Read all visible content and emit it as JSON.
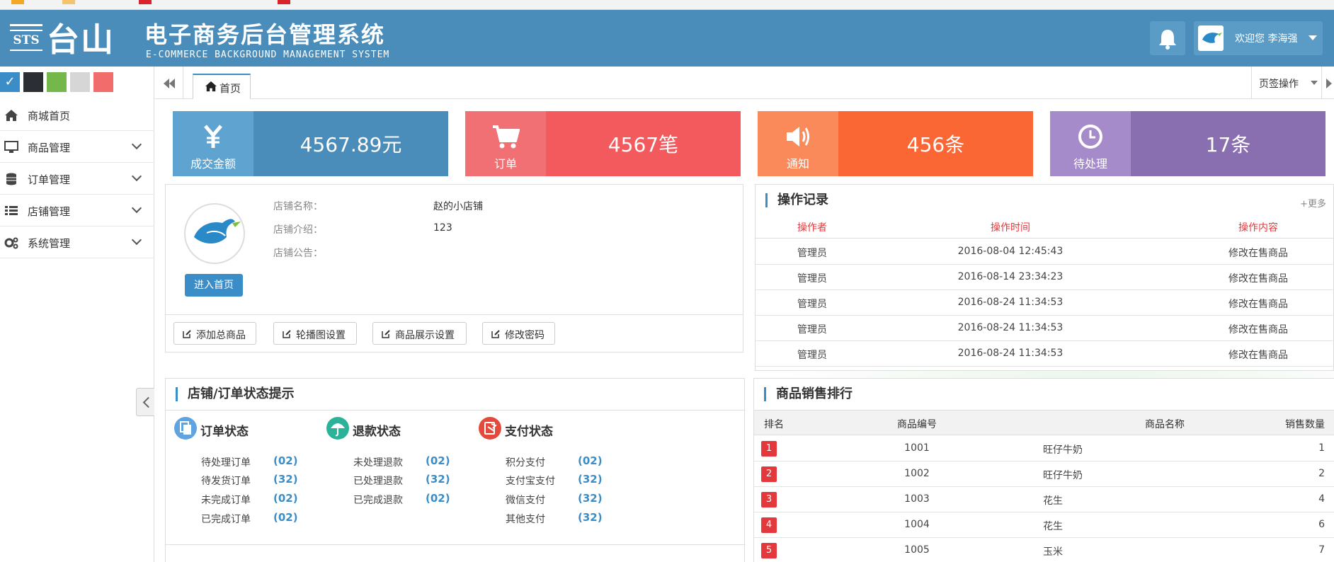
{
  "header": {
    "logo_sts": "STS",
    "logo_text": "台山",
    "title": "电子商务后台管理系统",
    "subtitle": "E-COMMERCE BACKGROUND MANAGEMENT SYSTEM",
    "welcome": "欢迎您 李海强",
    "bell_icon": "bell-icon"
  },
  "theme_swatches": [
    "#3b8dc8",
    "#2b2f33",
    "#74b84b",
    "#d6d6d6",
    "#f36c6c"
  ],
  "sidebar": {
    "items": [
      {
        "label": "商城首页",
        "icon": "home-icon"
      },
      {
        "label": "商品管理",
        "icon": "monitor-icon"
      },
      {
        "label": "订单管理",
        "icon": "database-icon"
      },
      {
        "label": "店铺管理",
        "icon": "list-icon"
      },
      {
        "label": "系统管理",
        "icon": "gears-icon"
      }
    ]
  },
  "tabs": {
    "home": "首页",
    "ops": "页签操作"
  },
  "stats": [
    {
      "label": "成交金额",
      "value": "4567.89元",
      "icon": "yen-icon",
      "left_color": "#5fa3d0",
      "right_color": "#4a8dba"
    },
    {
      "label": "订单",
      "value": "4567笔",
      "icon": "cart-icon",
      "left_color": "#f07074",
      "right_color": "#f25a5e"
    },
    {
      "label": "通知",
      "value": "456条",
      "icon": "speaker-icon",
      "left_color": "#fb8a5a",
      "right_color": "#fb6635"
    },
    {
      "label": "待处理",
      "value": "17条",
      "icon": "clock-icon",
      "left_color": "#a58bc9",
      "right_color": "#8a6fb0"
    }
  ],
  "store": {
    "name_label": "店铺名称：",
    "name_value": "赵的小店铺",
    "intro_label": "店铺介绍：",
    "intro_value": "123",
    "notice_label": "店铺公告：",
    "enter_button": "进入首页",
    "actions": [
      "添加总商品",
      "轮播图设置",
      "商品展示设置",
      "修改密码"
    ]
  },
  "ops_record": {
    "title": "操作记录",
    "more": "+更多",
    "headers": [
      "操作者",
      "操作时间",
      "操作内容"
    ],
    "rows": [
      [
        "管理员",
        "2016-08-04 12:45:43",
        "修改在售商品"
      ],
      [
        "管理员",
        "2016-08-14 23:34:23",
        "修改在售商品"
      ],
      [
        "管理员",
        "2016-08-24 11:34:53",
        "修改在售商品"
      ],
      [
        "管理员",
        "2016-08-24 11:34:53",
        "修改在售商品"
      ],
      [
        "管理员",
        "2016-08-24 11:34:53",
        "修改在售商品"
      ]
    ]
  },
  "status_panel": {
    "title": "店铺/订单状态提示",
    "groups": [
      {
        "title": "订单状态",
        "icon": "copy-icon",
        "color": "#5fa3e0",
        "items": [
          [
            "待处理订单",
            "(02)"
          ],
          [
            "待发货订单",
            "(32)"
          ],
          [
            "未完成订单",
            "(02)"
          ],
          [
            "已完成订单",
            "(02)"
          ]
        ]
      },
      {
        "title": "退款状态",
        "icon": "umbrella-icon",
        "color": "#2bb39a",
        "items": [
          [
            "未处理退款",
            "(02)"
          ],
          [
            "已处理退款",
            "(32)"
          ],
          [
            "已完成退款",
            "(02)"
          ]
        ]
      },
      {
        "title": "支付状态",
        "icon": "payment-icon",
        "color": "#e4493c",
        "items": [
          [
            "积分支付",
            "(02)"
          ],
          [
            "支付宝支付",
            "(32)"
          ],
          [
            "微信支付",
            "(32)"
          ],
          [
            "其他支付",
            "(32)"
          ]
        ]
      }
    ]
  },
  "ranking": {
    "title": "商品销售排行",
    "headers": [
      "排名",
      "商品编号",
      "商品名称",
      "销售数量"
    ],
    "rows": [
      [
        "1",
        "1001",
        "旺仔牛奶",
        "1"
      ],
      [
        "2",
        "1002",
        "旺仔牛奶",
        "2"
      ],
      [
        "3",
        "1003",
        "花生",
        "4"
      ],
      [
        "4",
        "1004",
        "花生",
        "6"
      ],
      [
        "5",
        "1005",
        "玉米",
        "7"
      ]
    ]
  }
}
